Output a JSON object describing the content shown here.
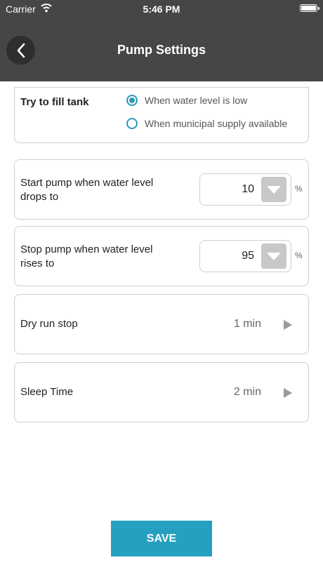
{
  "status_bar": {
    "carrier": "Carrier",
    "time": "5:46 PM"
  },
  "header": {
    "title": "Pump Settings",
    "back_icon": "chevron-left-icon",
    "background": "#464646"
  },
  "fill_tank": {
    "label": "Try to fill tank",
    "options": [
      {
        "label": "When water level is low",
        "selected": true
      },
      {
        "label": "When municipal supply available",
        "selected": false
      }
    ],
    "accent": "#2a9bb5"
  },
  "start_pump": {
    "label": "Start pump when water level drops to",
    "value": "10",
    "unit": "%"
  },
  "stop_pump": {
    "label": "Stop pump when water level rises to",
    "value": "95",
    "unit": "%"
  },
  "dry_run": {
    "label": "Dry run stop",
    "value": "1 min"
  },
  "sleep_time": {
    "label": "Sleep Time",
    "value": "2 min"
  },
  "save_button": {
    "label": "SAVE",
    "color": "#26a0c0"
  }
}
